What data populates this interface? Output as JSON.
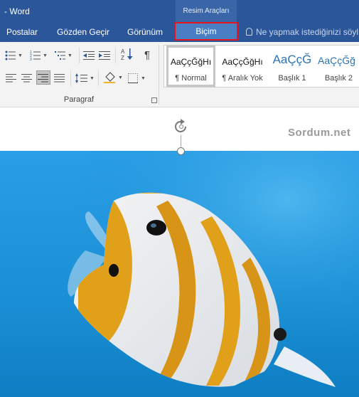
{
  "window": {
    "title": "- Word",
    "context_group": "Resim Araçları"
  },
  "tabs": [
    {
      "label": "Postalar"
    },
    {
      "label": "Gözden Geçir"
    },
    {
      "label": "Görünüm"
    },
    {
      "label": "Biçim",
      "active": true
    }
  ],
  "tell_me": {
    "placeholder": "Ne yapmak istediğinizi söyl"
  },
  "ribbon": {
    "paragraph_group_label": "Paragraf",
    "pilcrow": "¶",
    "styles": [
      {
        "sample": "AaÇçĞğHı",
        "name": "¶ Normal",
        "selected": true
      },
      {
        "sample": "AaÇçĞğHı",
        "name": "¶ Aralık Yok"
      },
      {
        "sample": "AaÇçĞ",
        "name": "Başlık 1"
      },
      {
        "sample": "AaÇçĞğ",
        "name": "Başlık 2"
      }
    ]
  },
  "document": {
    "watermark": "Sordum.net"
  },
  "colors": {
    "title_bar": "#2b579a",
    "active_tab": "#4a7ec4",
    "highlight_border": "#e8141b",
    "heading_blue": "#2e74b5",
    "water": "#1b8fd6",
    "fish_orange": "#e0a01a"
  },
  "picture": {
    "subject": "butterflyfish"
  }
}
